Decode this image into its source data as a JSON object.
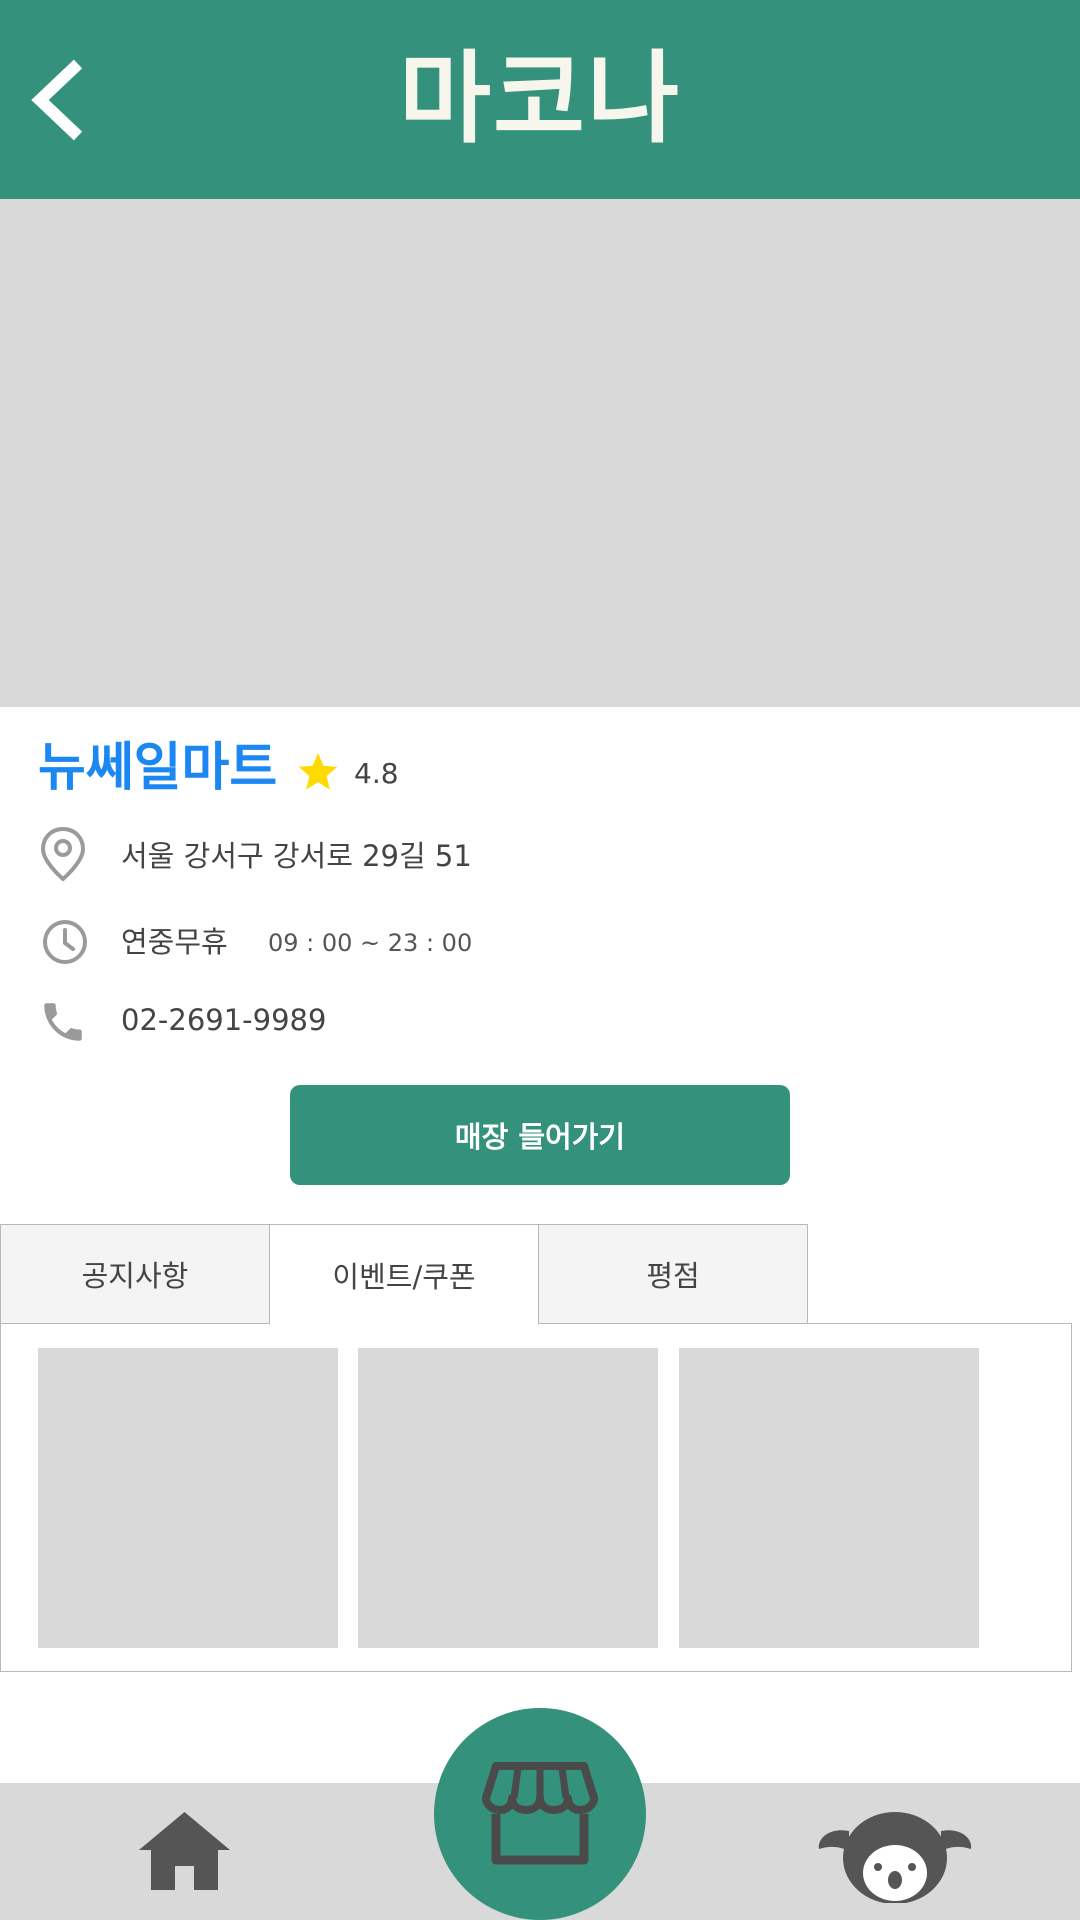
{
  "header": {
    "title": "마코나"
  },
  "store": {
    "name": "뉴쎄일마트",
    "rating": "4.8",
    "address": "서울 강서구 강서로 29길 51",
    "hours_label": "연중무휴",
    "hours_time": "09 : 00 ~ 23 : 00",
    "phone": "02-2691-9989",
    "enter_label": "매장 들어가기"
  },
  "tabs": [
    {
      "label": "공지사항",
      "active": false
    },
    {
      "label": "이벤트/쿠폰",
      "active": true
    },
    {
      "label": "평점",
      "active": false
    }
  ],
  "colors": {
    "primary": "#33917c",
    "store_name": "#1b87f2",
    "star": "#fddb00",
    "placeholder": "#d9d9d9",
    "icon_gray": "#9a9a9a",
    "nav_icon": "#555555"
  },
  "icons": {
    "back": "chevron-left-icon",
    "star": "star-icon",
    "location": "map-pin-icon",
    "clock": "clock-icon",
    "phone": "phone-icon",
    "home": "home-icon",
    "store": "storefront-icon",
    "profile": "koala-icon"
  }
}
